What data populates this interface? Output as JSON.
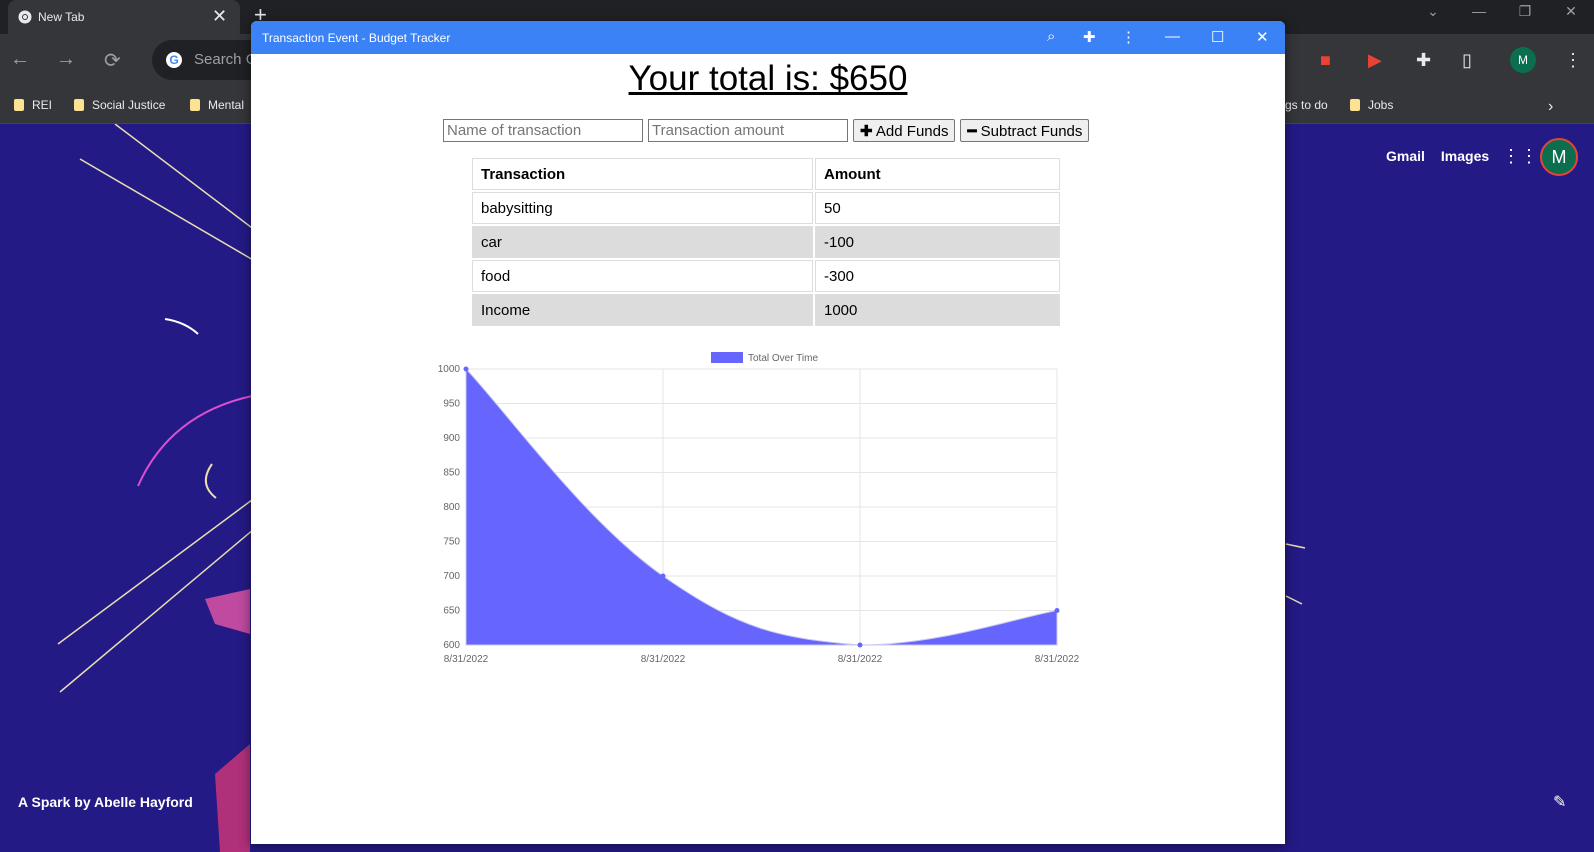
{
  "browser": {
    "tab_title": "New Tab",
    "omnibox_placeholder": "Search G",
    "bookmarks": [
      "REI",
      "Social Justice",
      "Mental",
      "gs to do",
      "Jobs"
    ],
    "profile_initial": "M"
  },
  "ntp": {
    "links": [
      "Gmail",
      "Images"
    ],
    "avatar_initial": "M",
    "credit": "A Spark by Abelle Hayford"
  },
  "app": {
    "window_title": "Transaction Event - Budget Tracker",
    "total_heading": "Your total is: $650",
    "name_placeholder": "Name of transaction",
    "amount_placeholder": "Transaction amount",
    "add_label": "Add Funds",
    "subtract_label": "Subtract Funds",
    "table": {
      "headers": [
        "Transaction",
        "Amount"
      ],
      "rows": [
        [
          "babysitting",
          "50"
        ],
        [
          "car",
          "-100"
        ],
        [
          "food",
          "-300"
        ],
        [
          "Income",
          "1000"
        ]
      ]
    }
  },
  "chart_data": {
    "type": "area",
    "x": [
      "8/31/2022",
      "8/31/2022",
      "8/31/2022",
      "8/31/2022"
    ],
    "series": [
      {
        "name": "Total Over Time",
        "values": [
          1000,
          700,
          600,
          650
        ],
        "color": "#6666ff"
      }
    ],
    "ylim": [
      600,
      1000
    ],
    "yticks": [
      600,
      650,
      700,
      750,
      800,
      850,
      900,
      950,
      1000
    ],
    "grid": true,
    "legend": "top-center"
  }
}
